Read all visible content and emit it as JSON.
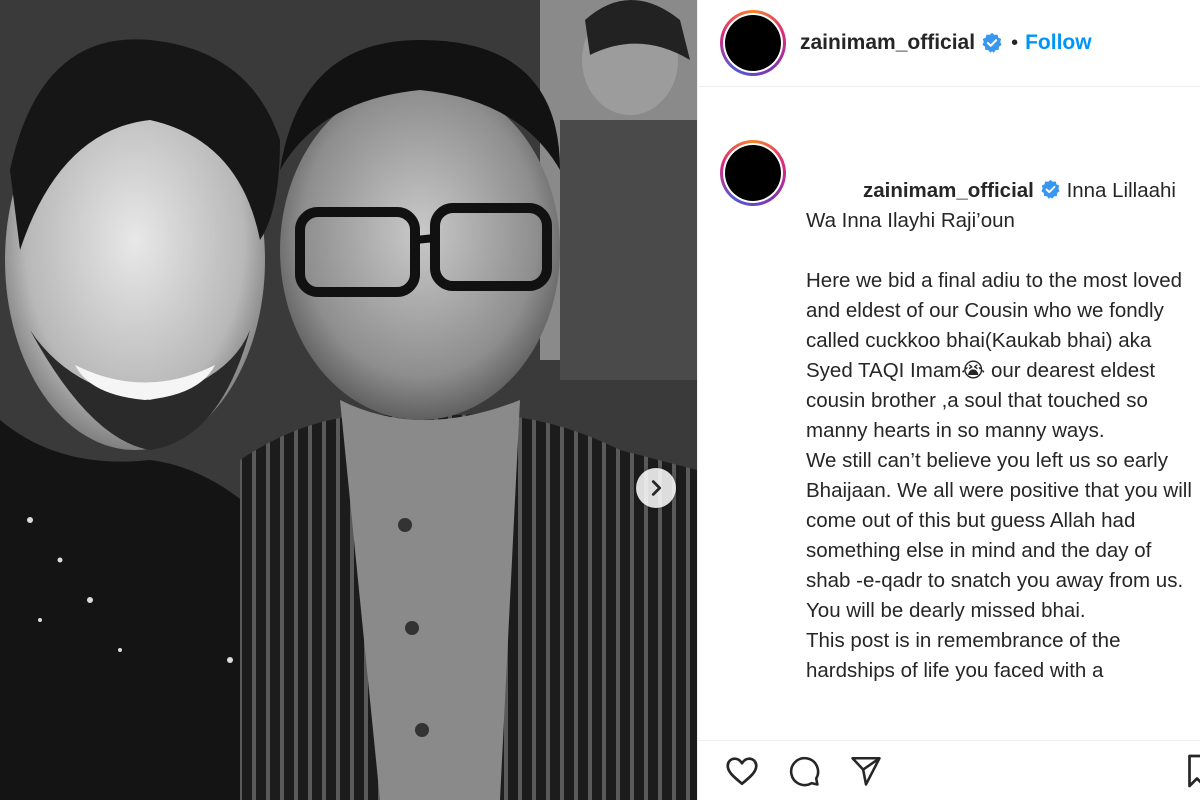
{
  "post": {
    "username": "zainimam_official",
    "follow_label": "Follow",
    "separator": "•",
    "caption_lines": [
      "Inna Lillaahi Wa Inna Ilayhi Raji’oun",
      "",
      "Here we bid a final adiu to the most loved and eldest of our Cousin who we fondly called cuckkoo bhai(Kaukab bhai) aka Syed TAQI Imam😭 our dearest eldest cousin brother ,a soul that touched so manny hearts in so manny ways.",
      "",
      "We still can’t believe you left us so early Bhaijaan. We all were positive that you will come out of this but guess Allah had something else in mind and the day of shab -e-qadr to snatch you away from us.",
      "You will be dearly missed bhai.",
      "This post is in remembrance of the hardships of life you faced with a"
    ]
  },
  "icons": {
    "verified": "verified-badge-icon",
    "next": "chevron-right-icon",
    "like": "heart-icon",
    "comment": "comment-icon",
    "share": "paper-plane-icon",
    "save": "bookmark-icon"
  },
  "colors": {
    "accent": "#0095f6",
    "text": "#262626",
    "divider": "#efefef"
  }
}
